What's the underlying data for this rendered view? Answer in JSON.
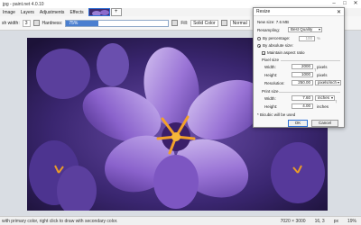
{
  "window": {
    "title": "jpg - paint.net 4.0.10"
  },
  "menu": {
    "items": [
      "Image",
      "Layers",
      "Adjustments",
      "Effects"
    ]
  },
  "toolbar": {
    "width_label": "sh width:",
    "width_value": "3",
    "hardness_label": "Hardness:",
    "hardness_value": "75%",
    "fill_label": "Fill:",
    "fill_value": "Solid Color",
    "blend_value": "Normal"
  },
  "status": {
    "hint": "with primary color, right click to draw with secondary color.",
    "size": "7020 × 3000",
    "coords": "16, 3",
    "units": "px",
    "zoom": "19%"
  },
  "dialog": {
    "title": "Resize",
    "new_size": "New size: 7.6 MB",
    "resampling_label": "Resampling:",
    "resampling_value": "Best Quality",
    "by_percentage": "By percentage:",
    "percentage_value": "100",
    "percent_sign": "%",
    "by_absolute": "By absolute size:",
    "maintain_aspect": "Maintain aspect ratio",
    "pixel_size": "Pixel size",
    "width_label": "Width:",
    "width_value": "2000",
    "width_unit": "pixels",
    "height_label": "Height:",
    "height_value": "1000",
    "height_unit": "pixels",
    "resolution_label": "Resolution:",
    "resolution_value": "250.00",
    "resolution_unit": "pixels/inch",
    "print_size": "Print size",
    "print_width_label": "Width:",
    "print_width_value": "7.60",
    "print_width_unit": "inches",
    "print_height_label": "Height:",
    "print_height_value": "4.00",
    "print_height_unit": "inches",
    "footnote": "* Bicubic will be used",
    "ok": "OK",
    "cancel": "Cancel"
  }
}
